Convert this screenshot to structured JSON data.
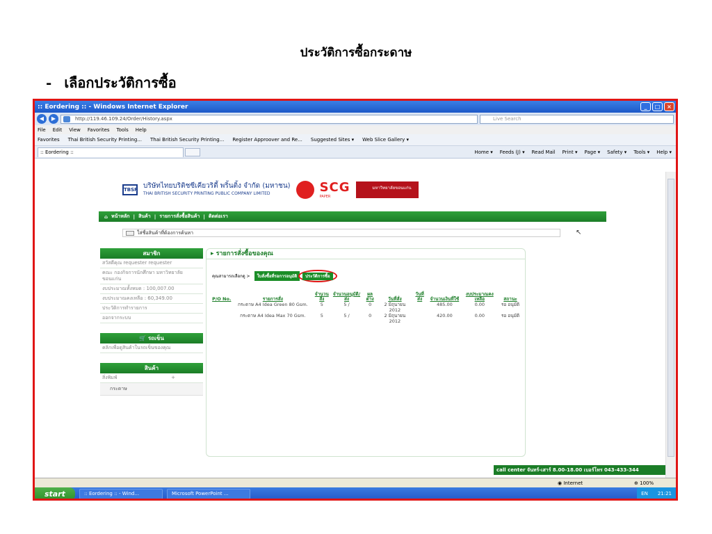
{
  "slide": {
    "title": "ประวัติการซื้อกระดาษ",
    "bullet_dash": "-",
    "bullet": "เลือกประวัติการซื้อ"
  },
  "window": {
    "title": ":: Eordering :: - Windows Internet Explorer",
    "url": "http://119.46.109.24/Order/History.aspx",
    "search_placeholder": "Live Search",
    "menu": [
      "File",
      "Edit",
      "View",
      "Favorites",
      "Tools",
      "Help"
    ],
    "favorites": [
      "Favorites",
      "Thai British Security Printing...",
      "Thai British Security Printing...",
      "Register Approover and Re...",
      "Suggested Sites ▾",
      "Web Slice Gallery ▾"
    ],
    "tab_title": ":: Eordering ::",
    "tools": [
      "Home ▾",
      "Feeds (J) ▾",
      "Read Mail",
      "Print ▾",
      "Page ▾",
      "Safety ▾",
      "Tools ▾",
      "Help ▾"
    ]
  },
  "site": {
    "company_th": "บริษัทไทยบริติชซีเคียวริตี้ พริ้นติ้ง จำกัด (มหาชน)",
    "company_en": "THAI BRITISH SECURITY PRINTING PUBLIC COMPANY LIMITED",
    "company_abbr": "TBSP",
    "scg": "SCG",
    "scg_sub": "PAPER",
    "university": "มหาวิทยาลัยขอนแก่น",
    "nav": [
      "หน้าหลัก",
      "สินค้า",
      "รายการสั่งซื้อสินค้า",
      "ติดต่อเรา"
    ],
    "search_placeholder": "ใส่ชื่อสินค้าที่ต้องการค้นหา"
  },
  "sidebar": {
    "member_head": "สมาชิก",
    "member_items": [
      "สวัสดีคุณ requester requester",
      "คณะ กองกิจการนักศึกษา มหาวิทยาลัยขอนแก่น",
      "งบประมาณทั้งหมด : 100,007.00",
      "งบประมาณคงเหลือ : 60,349.00",
      "ประวัติการทำรายการ",
      "ออกจากระบบ"
    ],
    "cart_head": "รถเข็น",
    "cart_item": "คลิกเพื่อดูสินค้าในรถเข็นของคุณ",
    "product_head": "สินค้า",
    "product_cat": "สิ่งพิมพ์",
    "product_cat_toggle": "+",
    "product_sub": "กระดาษ"
  },
  "main": {
    "head": "รายการสั่งซื้อของคุณ",
    "subnav_label": "คุณสามารถเลือกดู >",
    "subnav_pending": "ใบสั่งซื้อที่รอการอนุมัติ",
    "subnav_history": "ประวัติการซื้อ",
    "columns": [
      "P/O No.",
      "รายการสั่ง",
      "จำนวนสั่ง",
      "จำนวนอนุมัติ/ส่ง",
      "ผลต่าง",
      "วันที่สั่ง",
      "วันที่ส่ง",
      "จำนวนเงินที่ใช้",
      "งบประมาณคงเหลือ",
      "สถานะ"
    ],
    "rows": [
      {
        "po": "",
        "item": "กระดาษ A4 Idea Green 80 Gsm.",
        "qty": "5",
        "approved": "5 /",
        "diff": "0",
        "order_date": "2 มิถุนายน 2012",
        "ship_date": "",
        "amount": "485.00",
        "balance": "0.00",
        "status": "รอ อนุมัติ"
      },
      {
        "po": "",
        "item": "กระดาษ A4 Idea Max 70 Gsm.",
        "qty": "5",
        "approved": "5 /",
        "diff": "0",
        "order_date": "2 มิถุนายน 2012",
        "ship_date": "",
        "amount": "420.00",
        "balance": "0.00",
        "status": "รอ อนุมัติ"
      }
    ],
    "callcenter": "call center จันทร์-เสาร์ 8.00-18.00 เบอร์โทร 043-433-344"
  },
  "status": {
    "zone": "Internet",
    "zoom": "100%"
  },
  "taskbar": {
    "start": "start",
    "task1": ":: Eordering :: - Wind...",
    "task2": "Microsoft PowerPoint ...",
    "lang": "EN",
    "clock": "21:21"
  }
}
